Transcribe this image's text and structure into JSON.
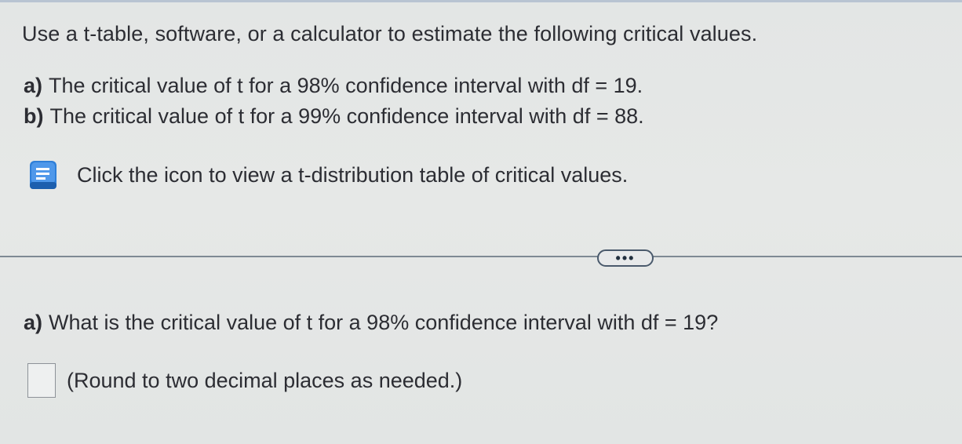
{
  "instructions": "Use a t-table, software, or a calculator to estimate the following critical values.",
  "parts": [
    {
      "tag": "a)",
      "text": "The critical value of t for a 98% confidence interval with df = 19."
    },
    {
      "tag": "b)",
      "text": "The critical value of t for a 99% confidence interval with df = 88."
    }
  ],
  "table_link": {
    "icon": "book-icon",
    "label": "Click the icon to view a t-distribution table of critical values."
  },
  "more_button": {
    "label": "•••"
  },
  "question": {
    "tag": "a)",
    "text": "What is the critical value of t for a 98% confidence interval with df = 19?"
  },
  "answer": {
    "value": "",
    "note": "(Round to two decimal places as needed.)"
  },
  "colors": {
    "icon_blue": "#2f7fd8",
    "divider": "#7f8a94"
  }
}
